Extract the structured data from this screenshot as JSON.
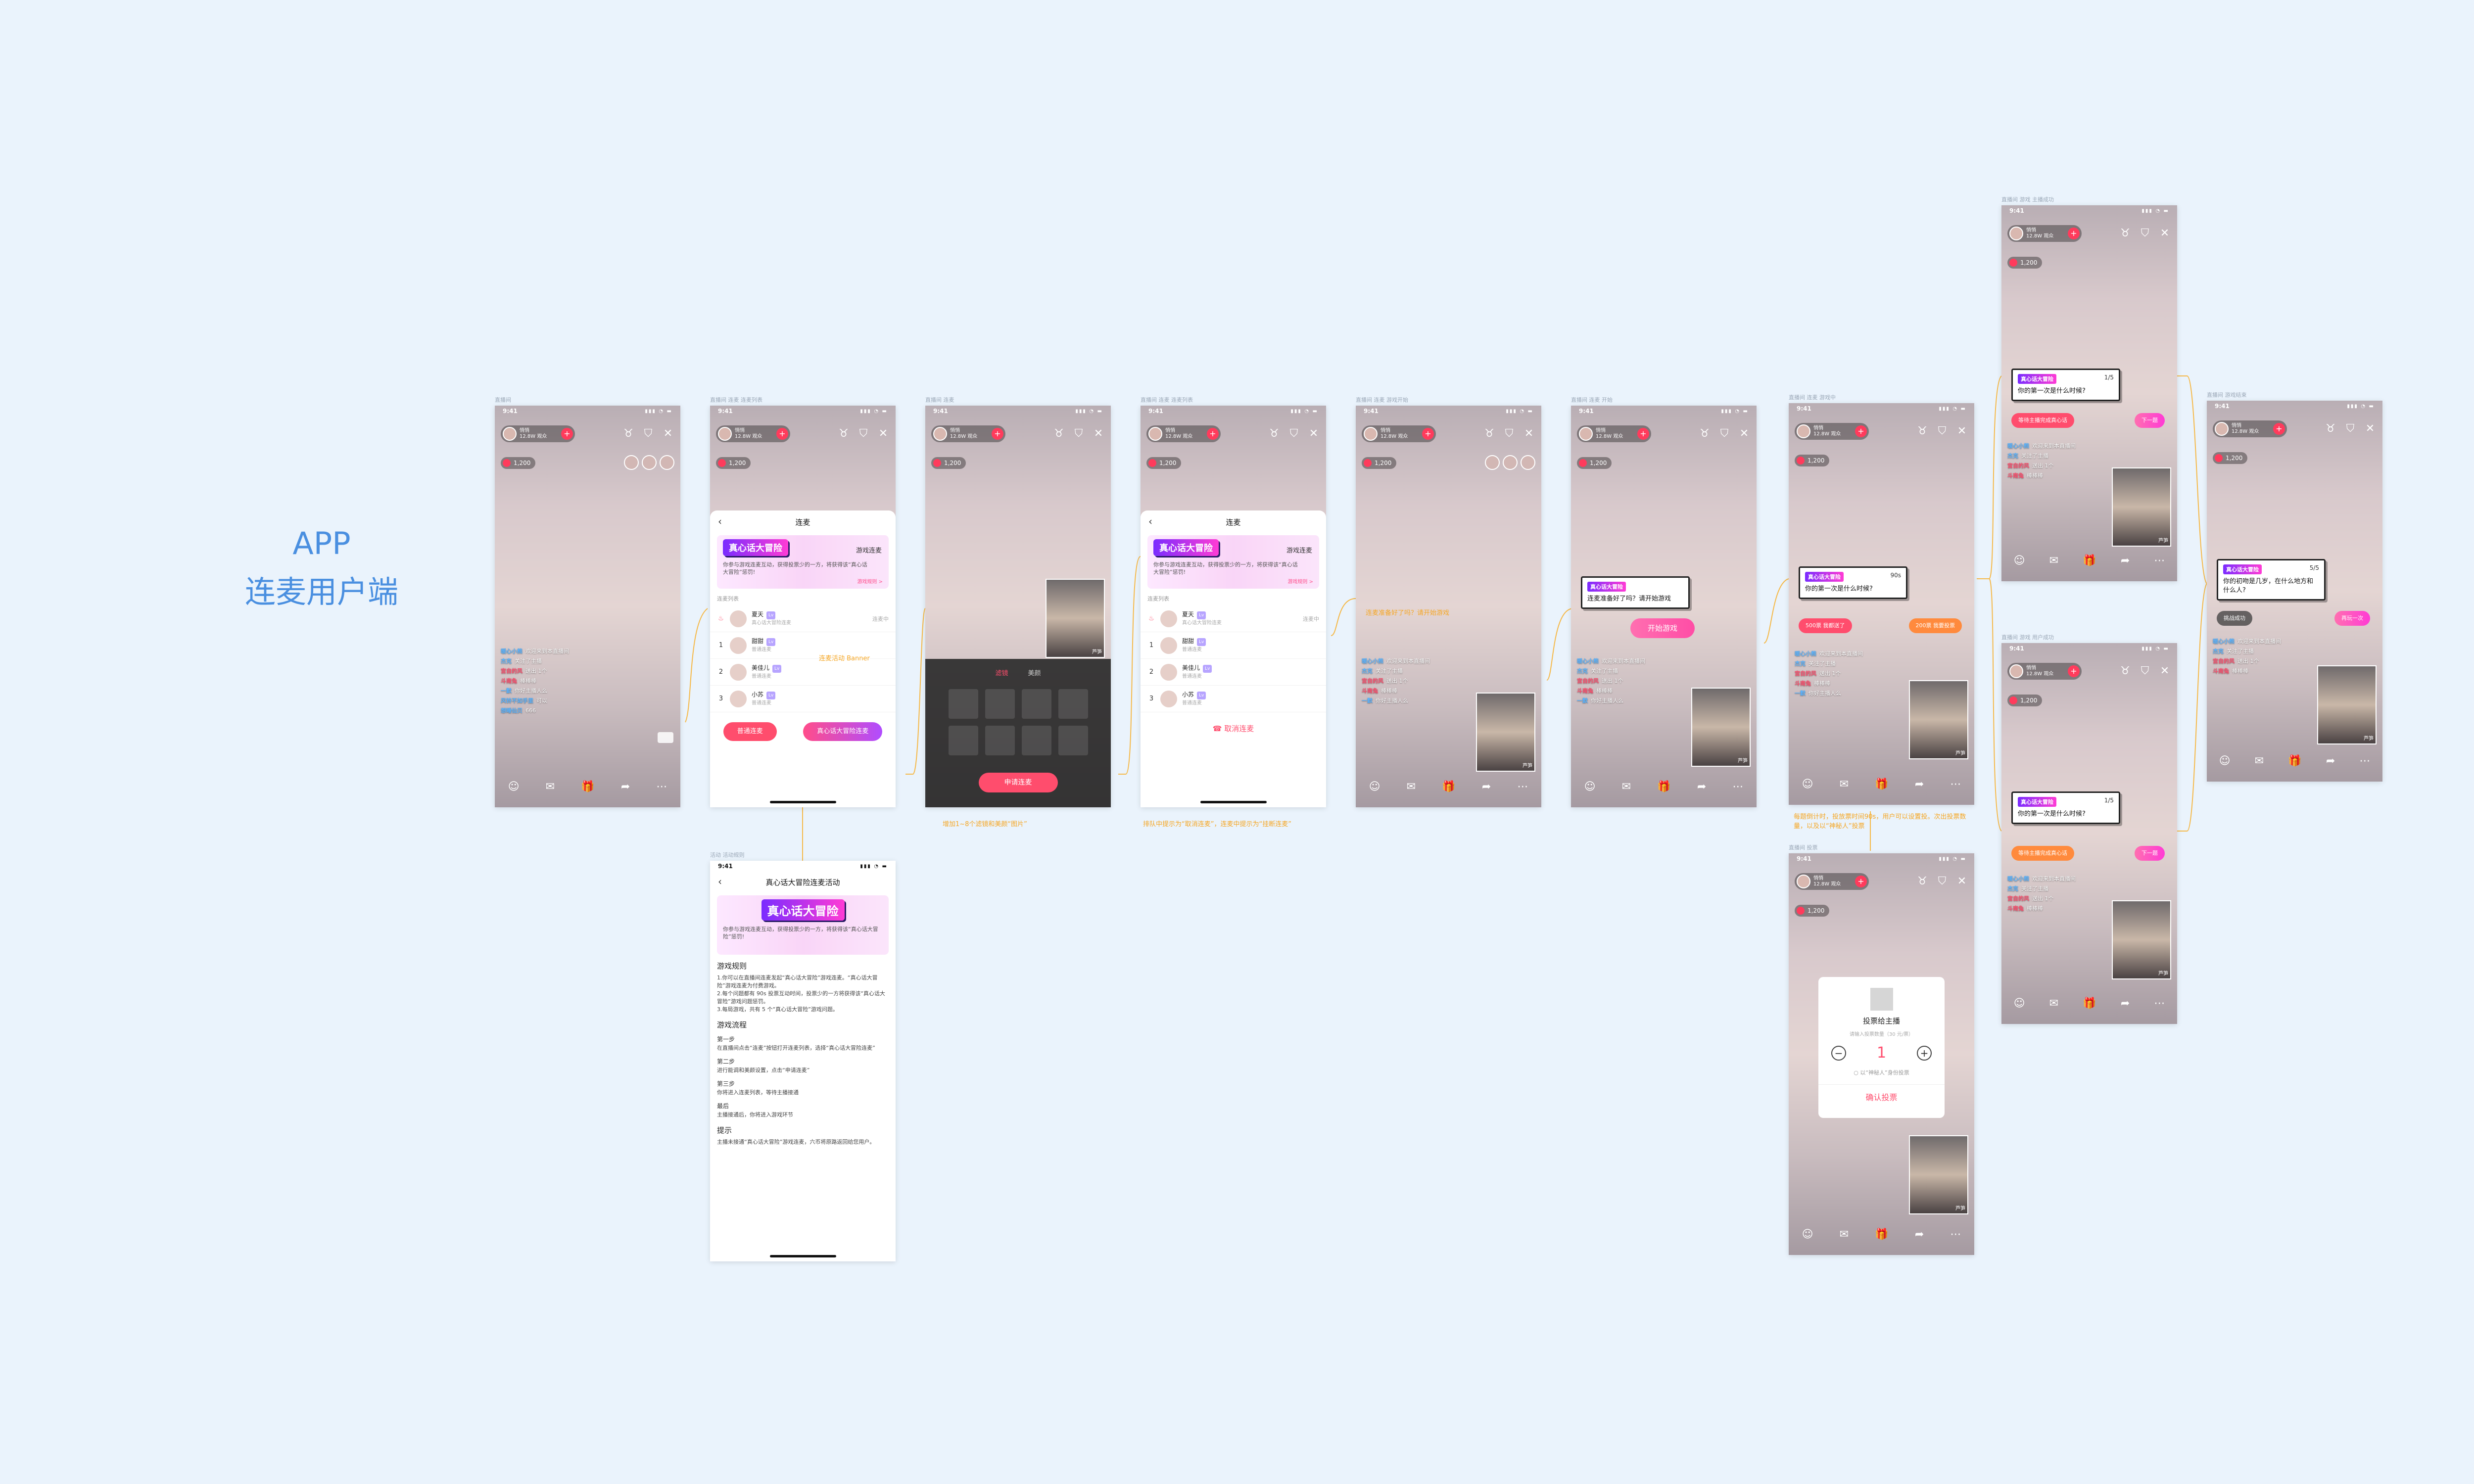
{
  "board": {
    "title_line1": "APP",
    "title_line2": "连麦用户端"
  },
  "live": {
    "time": "9:41",
    "host_name": "悄悄",
    "host_meta": "12.8W 观众",
    "coin_count": "1,200",
    "chat": [
      {
        "user": "暖心小熊",
        "text": "欢迎来到本直播间"
      },
      {
        "user": "杰克",
        "text": "关注了主播"
      },
      {
        "user": "宫自的风",
        "text": "送出 1个"
      },
      {
        "user": "斗南兔",
        "text": "棒棒棒"
      },
      {
        "user": "一默",
        "text": "你好主播人么"
      },
      {
        "user": "风铃不如手里",
        "text": "可以"
      },
      {
        "user": "想睡仙贝",
        "text": "666"
      }
    ],
    "guest_name": "芦笋"
  },
  "sheet": {
    "title": "连麦",
    "banner_logo": "真心话大冒险",
    "banner_sub": "游戏连麦",
    "banner_desc": "你参与游戏连麦互动，获得投票少的一方，将获得该“真心话大冒险”惩罚!",
    "banner_link": "游戏规则 >",
    "list_title": "连麦列表",
    "rows": [
      {
        "rank": "",
        "name": "夏天",
        "sub": "真心话大冒险连麦",
        "state": "连麦中"
      },
      {
        "rank": "1",
        "name": "甜甜",
        "sub": "普通连麦",
        "state": ""
      },
      {
        "rank": "2",
        "name": "美佳儿",
        "sub": "普通连麦",
        "state": ""
      },
      {
        "rank": "3",
        "name": "小苏",
        "sub": "普通连麦",
        "state": ""
      }
    ],
    "btn_normal": "普通连麦",
    "btn_game": "真心话大冒险连麦",
    "btn_cancel": "取消连麦"
  },
  "beauty": {
    "tab_filter": "滤镜",
    "tab_beauty": "美颜",
    "apply_button": "申请连麦"
  },
  "game": {
    "ready_text": "连麦准备好了吗？请开始游戏",
    "start_button": "开始游戏",
    "counter_90": "90s",
    "counter_1": "1/5",
    "counter_5": "5/5",
    "question_1": "你的第一次是什么时候?",
    "question_2": "你的初吻是几岁，在什么地方和什么人?",
    "vote_a": "500票 我都送了",
    "vote_b": "200票 我要投票",
    "waiting": "等待主播完成真心话",
    "next": "下一题",
    "win_label": "挑战成功",
    "end_label": "再玩一次"
  },
  "vote_dialog": {
    "title": "投票给主播",
    "hint": "请输入投票数量（30 元/票）",
    "value": "1",
    "option": "以“神秘人”身份投票",
    "confirm": "确认投票"
  },
  "rules_page": {
    "title": "真心话大冒险连麦活动",
    "intro": "你参与游戏连麦互动，获得投票少的一方，将获得该“真心话大冒险”惩罚!",
    "h_rules": "游戏规则",
    "rules_text": "1.你可以在直播间连麦发起“真心话大冒险”游戏连麦。“真心话大冒险”游戏连麦为付费游戏。\n2.每个问题都有 90s 投票互动时间，投票少的一方将获得该“真心话大冒险”游戏问题惩罚。\n3.每局游戏，共有 5 个“真心话大冒险”游戏问题。",
    "h_flow": "游戏流程",
    "s1_title": "第一步",
    "s1_text": "在直播间点击“连麦”按钮打开连麦列表，选择“真心话大冒险连麦”",
    "s2_title": "第二步",
    "s2_text": "进行能调和美颜设置，点击“申请连麦”",
    "s3_title": "第三步",
    "s3_text": "你将进入连麦列表，等待主播接通",
    "s4_title": "最后",
    "s4_text": "主播接通后，你将进入游戏环节",
    "h_tips": "提示",
    "tips_text": "主播未接通“真心话大冒险”游戏连麦，六币将原路返回给您用户。"
  },
  "notes": {
    "banner_note": "连麦活动 Banner",
    "beauty_note": "增加1~8个滤镜和美颜“图片”",
    "queue_note": "排队中提示为“取消连麦”，连麦中提示为“挂断连麦”",
    "ready_note": "连麦准备好了吗？请开始游戏",
    "vote_note": "每题倒计时，投放票时间90s，用户可以设置投。次出投票数量，以及以“神秘人”投票"
  },
  "frame_labels": [
    "直播间",
    "直播间 连麦 连麦列表",
    "直播间 连麦",
    "直播间 连麦 连麦列表",
    "直播间 连麦 游戏开始",
    "直播间 连麦 开始",
    "直播间 连麦 游戏中",
    "直播间 游戏 主播成功",
    "直播间 游戏 用户成功",
    "直播间 游戏结束",
    "直播间 投票",
    "活动 活动规则"
  ]
}
